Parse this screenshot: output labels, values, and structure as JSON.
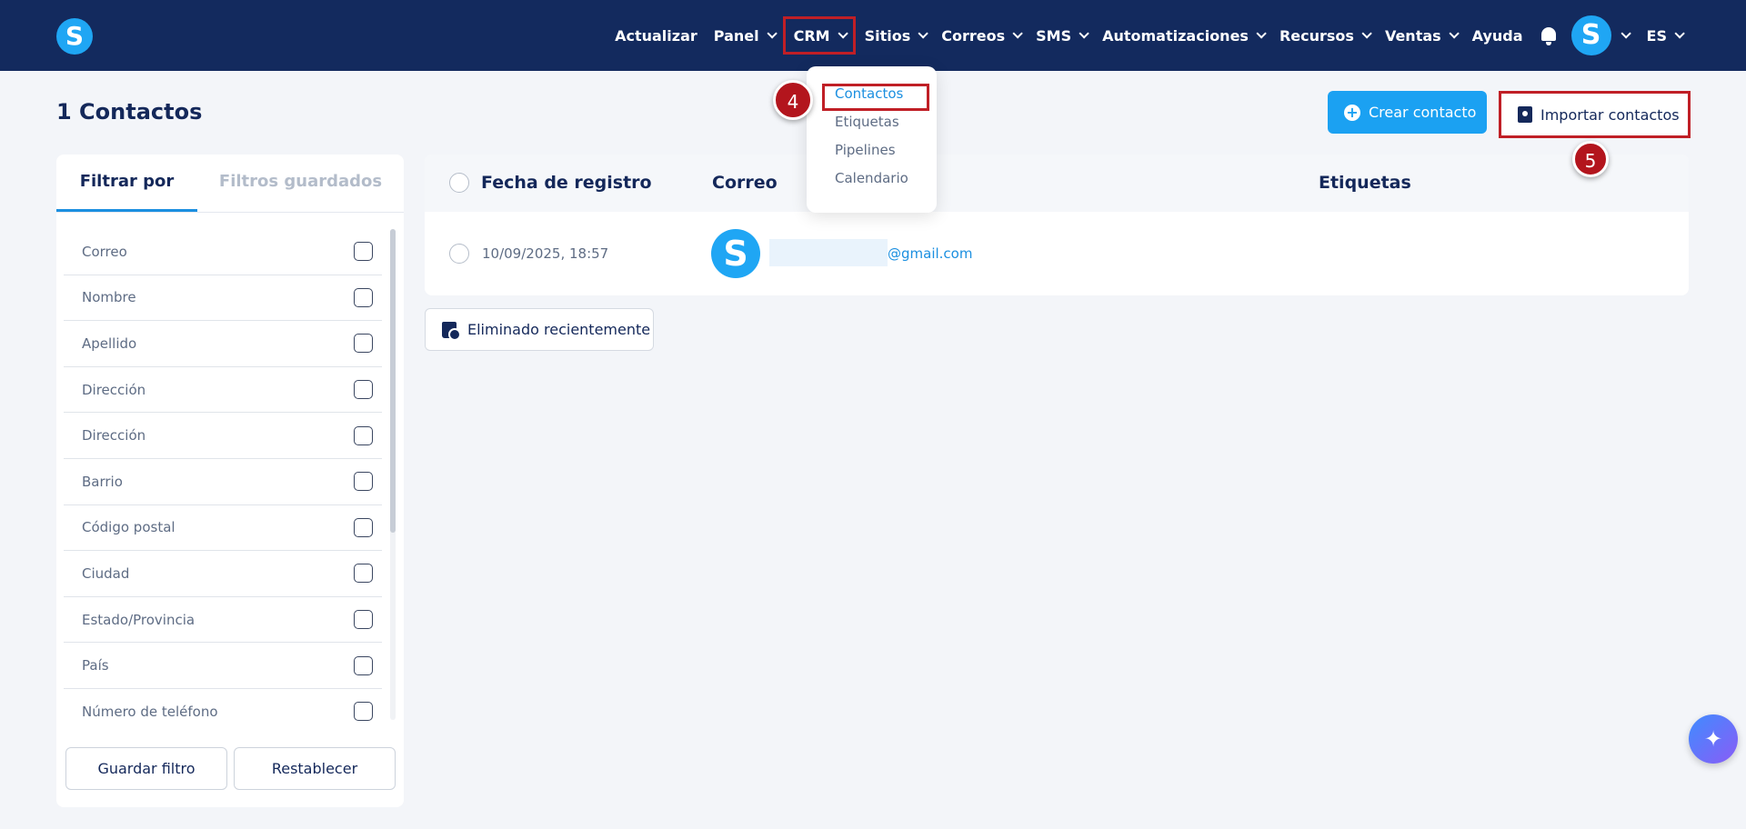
{
  "app": {
    "logo_letter": "S",
    "avatar_letter": "S"
  },
  "nav": {
    "items": [
      {
        "label": "Actualizar",
        "dropdown": false
      },
      {
        "label": "Panel",
        "dropdown": true
      },
      {
        "label": "CRM",
        "dropdown": true
      },
      {
        "label": "Sitios",
        "dropdown": true
      },
      {
        "label": "Correos",
        "dropdown": true
      },
      {
        "label": "SMS",
        "dropdown": true
      },
      {
        "label": "Automatizaciones",
        "dropdown": true
      },
      {
        "label": "Recursos",
        "dropdown": true
      },
      {
        "label": "Ventas",
        "dropdown": true
      },
      {
        "label": "Ayuda",
        "dropdown": false
      }
    ],
    "language": "ES"
  },
  "crm_menu": {
    "items": [
      "Contactos",
      "Etiquetas",
      "Pipelines",
      "Calendario"
    ],
    "selected": "Contactos"
  },
  "steps": {
    "step_4": "4",
    "step_5": "5"
  },
  "page": {
    "title": "1 Contactos",
    "create_label": "Crear contacto",
    "import_label": "Importar contactos"
  },
  "filters": {
    "tabs": [
      "Filtrar por",
      "Filtros guardados"
    ],
    "active_tab": "Filtrar por",
    "fields": [
      "Correo",
      "Nombre",
      "Apellido",
      "Dirección",
      "Dirección",
      "Barrio",
      "Código postal",
      "Ciudad",
      "Estado/Provincia",
      "País",
      "Número de teléfono"
    ],
    "save_label": "Guardar filtro",
    "reset_label": "Restablecer"
  },
  "table": {
    "headers": {
      "date": "Fecha de registro",
      "email": "Correo",
      "tags": "Etiquetas"
    },
    "rows": [
      {
        "date": "10/09/2025, 18:57",
        "avatar": "S",
        "email": "@gmail.com",
        "tags": ""
      }
    ]
  },
  "recently_deleted_label": "Eliminado recientemente",
  "colors": {
    "navbar": "#132a5e",
    "accent": "#1ba1f2",
    "highlight": "#c01f26",
    "marker": "#b3151d"
  },
  "icons": {
    "bell": "bell-icon",
    "fab": "sparkle-icon",
    "import": "contact-card-icon",
    "trash": "trash-clock-icon"
  }
}
